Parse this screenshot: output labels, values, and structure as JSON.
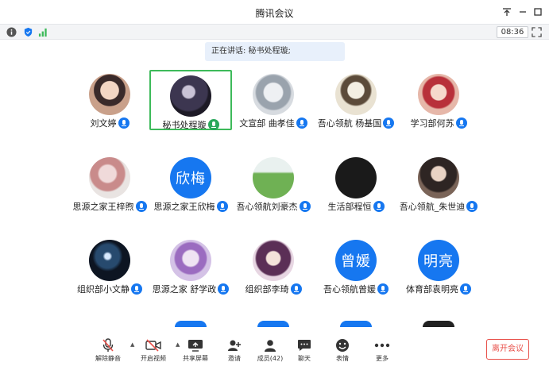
{
  "window": {
    "title": "腾讯会议"
  },
  "timer": "08:36",
  "speaking": "正在讲话: 秘书处程璇;",
  "participants": [
    {
      "name": "刘文婷",
      "mic": "blue",
      "avatar": "photo-girl-hanfu"
    },
    {
      "name": "秘书处程璇",
      "mic": "green",
      "avatar": "photo-dark-portrait",
      "active": true
    },
    {
      "name": "文宣部 曲孝佳",
      "mic": "blue",
      "avatar": "photo-anime-sketch"
    },
    {
      "name": "吾心领航 杨基国",
      "mic": "blue",
      "avatar": "photo-ink-figure"
    },
    {
      "name": "学习部何苏",
      "mic": "blue",
      "avatar": "photo-anime-red"
    },
    {
      "name": "思源之家王梓煦",
      "mic": "blue",
      "avatar": "photo-pink-items"
    },
    {
      "name": "思源之家王欣梅",
      "mic": "blue",
      "avatar_text": "欣梅"
    },
    {
      "name": "吾心领航刘豪杰",
      "mic": "blue",
      "avatar": "photo-grass"
    },
    {
      "name": "生活部程恒",
      "mic": "blue",
      "avatar": "photo-black-text"
    },
    {
      "name": "吾心领航_朱世迪",
      "mic": "blue",
      "avatar": "photo-anime-dark"
    },
    {
      "name": "组织部小文静",
      "mic": "blue",
      "avatar": "photo-blue-light"
    },
    {
      "name": "思源之家 舒学政",
      "mic": "blue",
      "avatar": "photo-purple-anime"
    },
    {
      "name": "组织部李琦",
      "mic": "blue",
      "avatar": "photo-anime-girl"
    },
    {
      "name": "吾心领航曾媛",
      "mic": "blue",
      "avatar_text": "曾媛"
    },
    {
      "name": "体育部袁明亮",
      "mic": "blue",
      "avatar_text": "明亮"
    }
  ],
  "toolbar": {
    "mute": "解除静音",
    "video": "开启视频",
    "share": "共享屏幕",
    "invite": "邀请",
    "members": "成员(42)",
    "chat": "聊天",
    "emoji": "表情",
    "more": "更多",
    "leave": "离开会议"
  },
  "colors": {
    "accent": "#1677f0",
    "active_border": "#3dba5a",
    "leave": "#e8504a"
  }
}
